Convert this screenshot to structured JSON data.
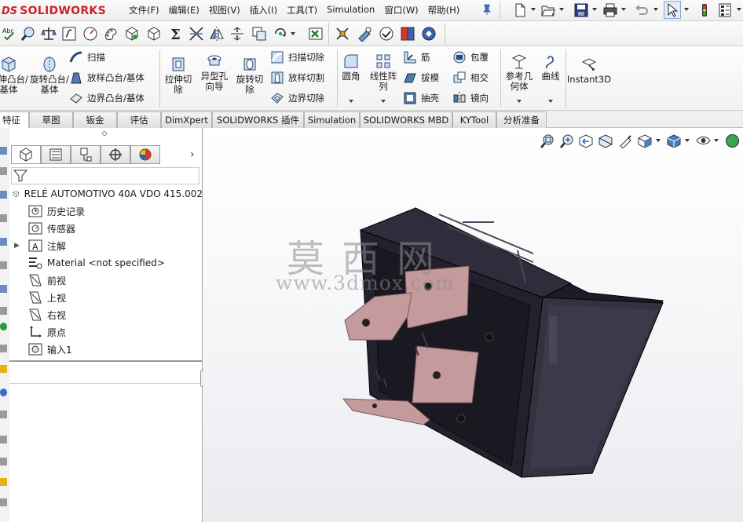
{
  "app": {
    "brand_prefix": "DS",
    "brand": "SOLIDWORKS"
  },
  "menus": [
    "文件(F)",
    "编辑(E)",
    "视图(V)",
    "插入(I)",
    "工具(T)",
    "Simulation",
    "窗口(W)",
    "帮助(H)"
  ],
  "quick_access_icons": [
    "new-document-icon",
    "open-icon",
    "save-icon",
    "print-icon",
    "undo-icon",
    "select-icon",
    "rebuild-icon",
    "options-icon"
  ],
  "row2_icons": [
    "spell-check-icon",
    "zoom-icon",
    "balance-icon",
    "equation-icon",
    "gauge-icon",
    "color-icon",
    "box-icon",
    "cube-icon",
    "sum-icon",
    "measure-icon",
    "mirror-icon",
    "split-icon",
    "copy-icon",
    "rotate-icon",
    "excel-icon",
    "plugin-icon",
    "toolbox-icon",
    "check-icon",
    "scan-icon",
    "sheet-icon"
  ],
  "ribbon": {
    "extrude_boss": "拉伸凸台/基体",
    "revolve_boss": "旋转凸台/基体",
    "sweep": "扫描",
    "loft": "放样凸台/基体",
    "boundary_boss": "边界凸台/基体",
    "extrude_cut": "拉伸切除",
    "hole_wizard": "异型孔向导",
    "revolve_cut": "旋转切除",
    "sweep_cut": "扫描切除",
    "loft_cut": "放样切割",
    "boundary_cut": "边界切除",
    "fillet": "圆角",
    "linear_pattern": "线性阵列",
    "rib": "筋",
    "draft": "拔模",
    "shell": "抽壳",
    "wrap": "包覆",
    "intersect": "相交",
    "mirror": "镜向",
    "ref_geometry": "参考几何体",
    "curves": "曲线",
    "instant3d": "Instant3D"
  },
  "tabs": [
    "特征",
    "草图",
    "钣金",
    "评估",
    "DimXpert",
    "SOLIDWORKS 插件",
    "Simulation",
    "SOLIDWORKS MBD",
    "KYTool",
    "分析准备"
  ],
  "tree": {
    "root": "RELÉ AUTOMOTIVO 40A VDO 415.002",
    "items": [
      "历史记录",
      "传感器",
      "注解",
      "Material <not specified>",
      "前视",
      "上视",
      "右视",
      "原点",
      "输入1"
    ]
  },
  "view_icons": [
    "zoom-to-fit-icon",
    "zoom-area-icon",
    "previous-view-icon",
    "section-view-icon",
    "dynamic-annotation-icon",
    "view-orientation-icon",
    "display-style-icon",
    "hide-show-icon",
    "appearance-icon"
  ],
  "watermark": {
    "cn": "莫西网",
    "url": "www.3dmox.com"
  },
  "colors": {
    "brand_red": "#d02128",
    "relay_body": "#2a2935",
    "terminal_copper": "#c49a9c"
  }
}
